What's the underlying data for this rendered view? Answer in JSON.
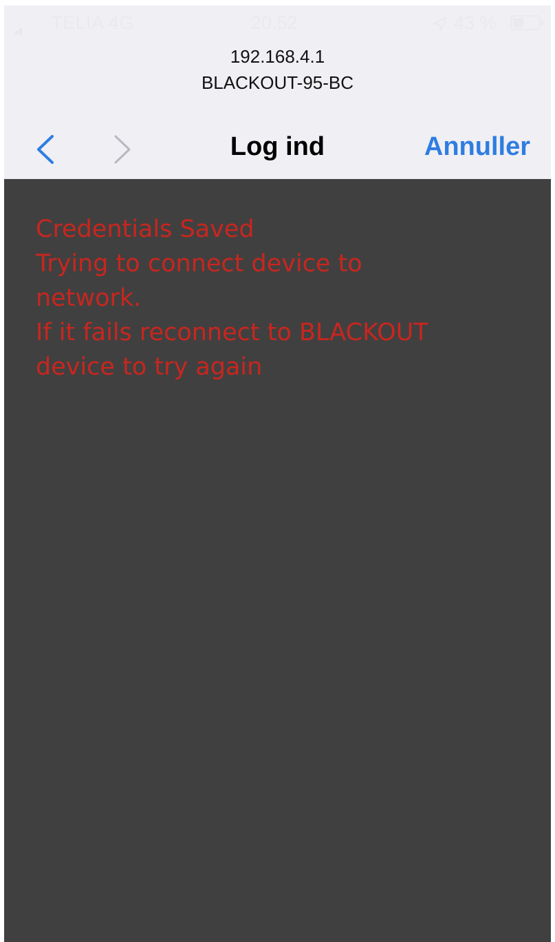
{
  "status_bar": {
    "carrier": "TELIA 4G",
    "time": "20.52",
    "battery_percent": "43 %",
    "battery_level": 0.43,
    "signal_icon": "signal-bars-icon",
    "location_icon": "location-arrow-icon",
    "battery_icon": "battery-icon"
  },
  "address": {
    "host": "192.168.4.1",
    "network": "BLACKOUT-95-BC"
  },
  "navbar": {
    "back_icon": "chevron-left-icon",
    "forward_icon": "chevron-right-icon",
    "title": "Log ind",
    "cancel_label": "Annuller"
  },
  "content": {
    "lines": [
      "Credentials Saved",
      "Trying to connect device to",
      "network.",
      "If it fails reconnect to BLACKOUT",
      "device to try again"
    ]
  },
  "colors": {
    "accent": "#2f7de1",
    "message": "#c8261f",
    "content_bg": "#404040",
    "chrome_bg": "#efeff4",
    "disabled": "#b8b8be"
  }
}
